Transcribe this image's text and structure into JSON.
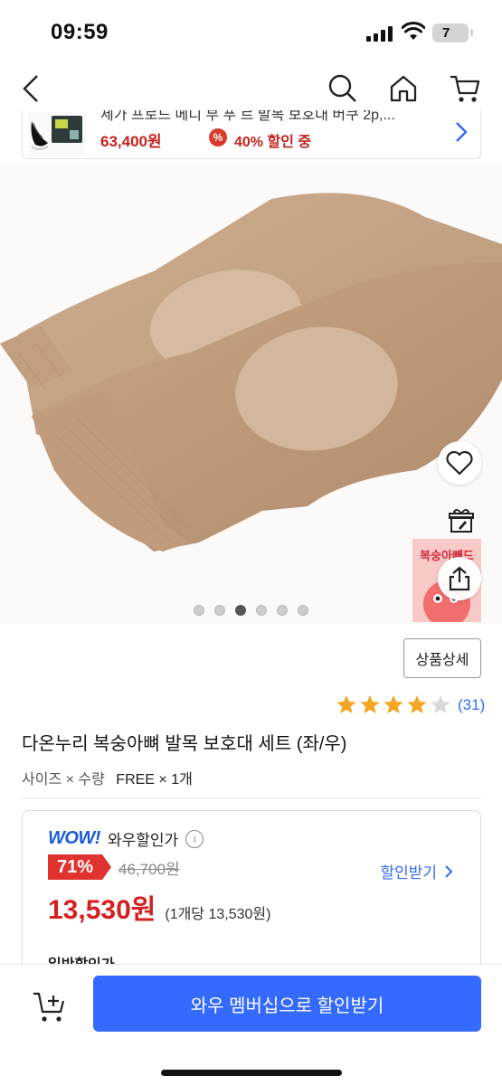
{
  "status_bar": {
    "time": "09:59",
    "battery": "7"
  },
  "related": {
    "title": "세가 프로드 메디 부 푸 르 발목 보호대 버쿠 2p,...",
    "price": "63,400원",
    "badge": "%",
    "discount": "40% 할인 중"
  },
  "hero": {
    "promo_text": "복숭아빼드",
    "dots_count": 6,
    "active_dot": 3
  },
  "detail_button": "상품상세",
  "rating": {
    "stars": 4.5,
    "count": "(31)"
  },
  "product": {
    "title": "다온누리 복숭아뼈 발목 보호대 세트 (좌/우)",
    "option_label": "사이즈 × 수량",
    "option_value": "FREE × 1개"
  },
  "price_box": {
    "wow_logo": "WOW!",
    "wow_label": "와우할인가",
    "info": "i",
    "discount_rate": "71%",
    "original_price": "46,700원",
    "discount_link": "할인받기",
    "final_price": "13,530원",
    "unit_price": "(1개당 13,530원)",
    "general_label": "일반할인가"
  },
  "bottom": {
    "cta": "와우 멤버십으로 할인받기"
  },
  "colors": {
    "accent": "#346aff",
    "price_red": "#d61f1f",
    "badge_red": "#e0322f",
    "star": "#f5a623"
  }
}
